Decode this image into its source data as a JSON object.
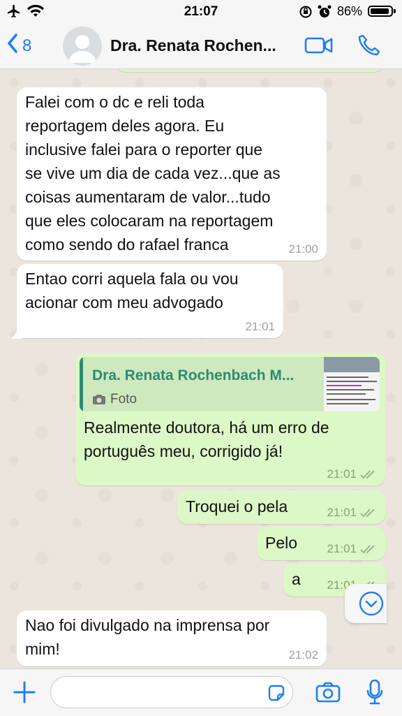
{
  "status_bar": {
    "time": "21:07",
    "battery_pct": "86%",
    "battery_level": 0.86
  },
  "header": {
    "back_count": "8",
    "contact_name": "Dra. Renata Rochen..."
  },
  "messages": [
    {
      "dir": "in",
      "lines": [
        "Falei com o dc e reli toda",
        "reportagem deles agora. Eu",
        "inclusive falei para o reporter que",
        "se vive um dia de cada vez...que as",
        "coisas aumentaram de valor...tudo",
        "que eles colocaram na reportagem",
        "como sendo do rafael franca"
      ],
      "time": "21:00"
    },
    {
      "dir": "in",
      "lines": [
        "Entao corri aquela fala ou vou",
        "acionar com meu advogado"
      ],
      "time": "21:01"
    },
    {
      "dir": "out",
      "reply_to": {
        "name": "Dra. Renata Rochenbach M...",
        "type": "Foto"
      },
      "lines": [
        "Realmente doutora, há um erro de",
        "português meu, corrigido já!"
      ],
      "time": "21:01",
      "status": "read"
    },
    {
      "dir": "out",
      "lines": [
        "Troquei o pela"
      ],
      "time": "21:01",
      "status": "read"
    },
    {
      "dir": "out",
      "lines": [
        "Pelo"
      ],
      "time": "21:01",
      "status": "read"
    },
    {
      "dir": "out",
      "lines": [
        "a"
      ],
      "time": "21:01",
      "status": "read"
    },
    {
      "dir": "in",
      "lines": [
        "Nao foi divulgado na imprensa por",
        "mim!"
      ],
      "time": "21:02"
    }
  ],
  "input": {
    "placeholder": ""
  },
  "icons": {
    "status": [
      "airplane-icon",
      "wifi-icon",
      "rotation-lock-icon",
      "alarm-icon",
      "battery-icon"
    ],
    "header": [
      "chevron-left-icon",
      "avatar-placeholder-icon",
      "video-camera-icon",
      "phone-icon"
    ],
    "input": [
      "plus-icon",
      "sticker-icon",
      "camera-icon",
      "microphone-icon"
    ],
    "chat": [
      "chevron-down-icon",
      "double-check-icon",
      "photo-camera-icon"
    ]
  },
  "colors": {
    "accent": "#1e7ef0",
    "incoming": "#ffffff",
    "outgoing": "#dcf8c6",
    "reply_accent": "#2d8a74",
    "read_ticks": "#86a07a"
  }
}
